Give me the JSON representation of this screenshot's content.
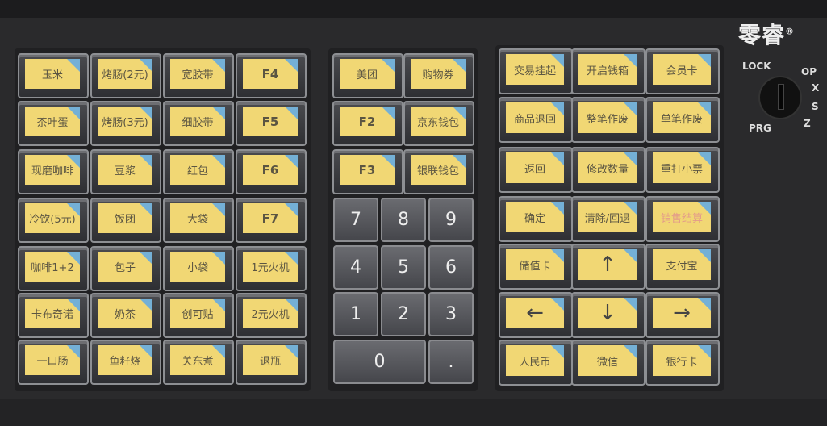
{
  "brand": {
    "logo_text": "零睿",
    "registered": "®"
  },
  "mode_switch": {
    "labels": [
      "LOCK",
      "OP",
      "X",
      "S",
      "Z",
      "PRG"
    ]
  },
  "left_keys": [
    [
      "玉米",
      "烤肠(2元)",
      "宽胶带",
      "F4"
    ],
    [
      "茶叶蛋",
      "烤肠(3元)",
      "细胶带",
      "F5"
    ],
    [
      "现磨咖啡",
      "豆浆",
      "红包",
      "F6"
    ],
    [
      "冷饮(5元)",
      "饭团",
      "大袋",
      "F7"
    ],
    [
      "咖啡1+2",
      "包子",
      "小袋",
      "1元火机"
    ],
    [
      "卡布奇诺",
      "奶茶",
      "创可贴",
      "2元火机"
    ],
    [
      "一口肠",
      "鱼籽烧",
      "关东煮",
      "退瓶"
    ]
  ],
  "middle_keys": [
    [
      "美团",
      "购物券"
    ],
    [
      "F2",
      "京东钱包"
    ],
    [
      "F3",
      "银联钱包"
    ]
  ],
  "numpad": [
    [
      "7",
      "8",
      "9"
    ],
    [
      "4",
      "5",
      "6"
    ],
    [
      "1",
      "2",
      "3"
    ],
    [
      "0",
      "."
    ]
  ],
  "right_keys": [
    [
      "交易挂起",
      "开启钱箱",
      "会员卡"
    ],
    [
      "商品退回",
      "整笔作废",
      "单笔作废"
    ],
    [
      "返回",
      "修改数量",
      "重打小票"
    ],
    [
      "确定",
      "清除/回退",
      "销售结算"
    ],
    [
      "储值卡",
      "↑",
      "支付宝"
    ],
    [
      "←",
      "↓",
      "→"
    ],
    [
      "人民币",
      "微信",
      "银行卡"
    ]
  ],
  "colors": {
    "label": "#f1d774",
    "corner": "#74b0d6",
    "body": "#2a2a2c",
    "settle_text": "#e39b8a"
  }
}
